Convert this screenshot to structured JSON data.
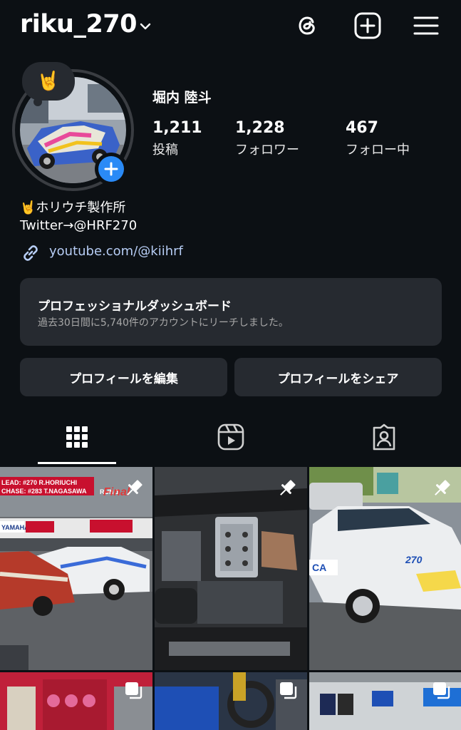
{
  "header": {
    "username": "riku_270"
  },
  "profile": {
    "note_emoji": "🤘",
    "display_name": "堀内 陸斗",
    "stats": [
      {
        "value": "1,211",
        "label": "投稿"
      },
      {
        "value": "1,228",
        "label": "フォロワー"
      },
      {
        "value": "467",
        "label": "フォロー中"
      }
    ],
    "bio_line1": "🤘ホリウチ製作所",
    "bio_line2": "Twitter→@HRF270",
    "link": "youtube.com/@kiihrf"
  },
  "dashboard": {
    "title": "プロフェッショナルダッシュボード",
    "subtitle": "過去30日間に5,740件のアカウントにリーチしました。"
  },
  "buttons": {
    "edit": "プロフィールを編集",
    "share": "プロフィールをシェア"
  },
  "posts": {
    "post1_overlay": [
      "LEAD: #270 R.HORIUCHI",
      "CHASE: #283 T.NAGASAWA"
    ],
    "post1_run": "RUN 1",
    "post1_final": "Final",
    "post1_sponsor": "YAMAHA",
    "post3_number": "270"
  },
  "colors": {
    "background": "#0c1014",
    "surface": "#262a30",
    "accent_blue": "#2a8af6",
    "link": "#b7cdf5"
  }
}
